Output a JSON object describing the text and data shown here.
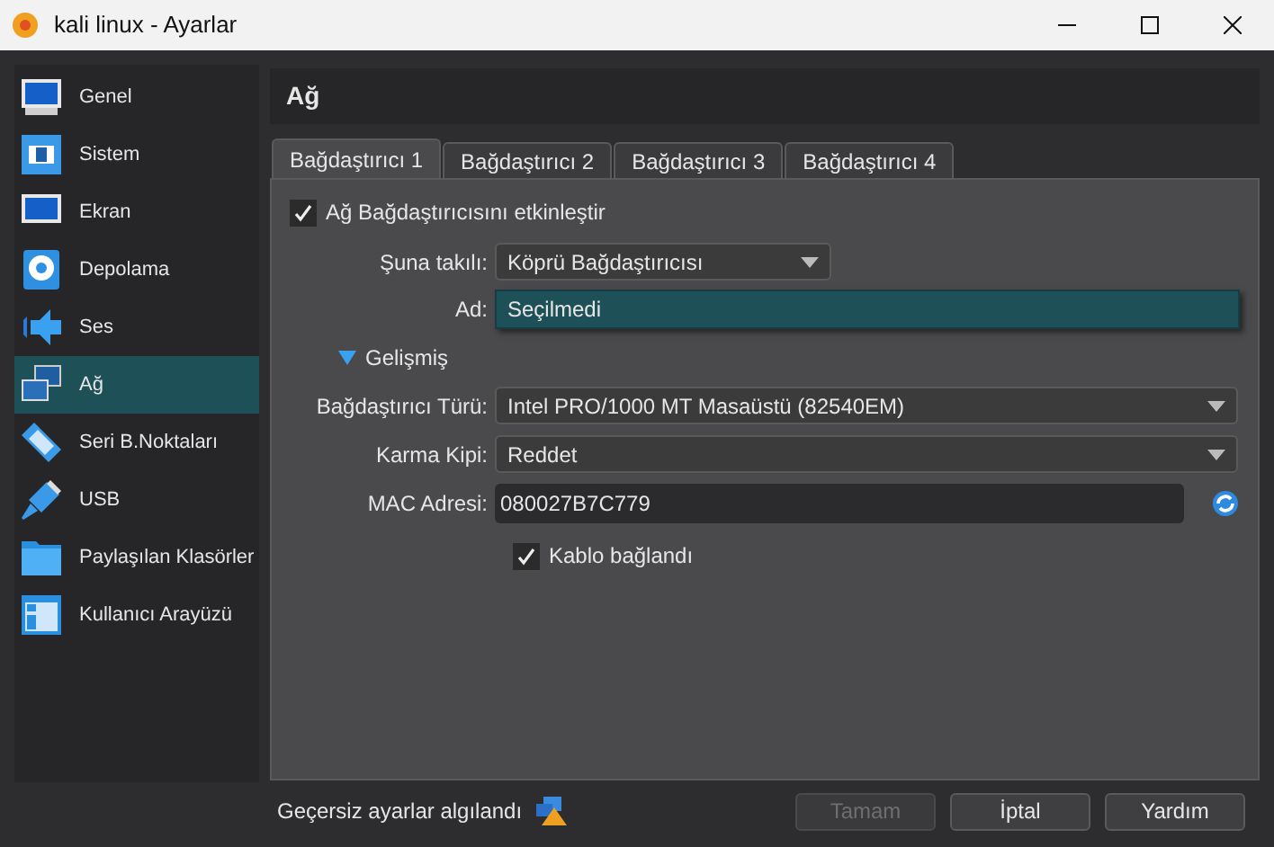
{
  "window": {
    "title": "kali linux - Ayarlar"
  },
  "sidebar": {
    "items": [
      {
        "label": "Genel",
        "selected": false
      },
      {
        "label": "Sistem",
        "selected": false
      },
      {
        "label": "Ekran",
        "selected": false
      },
      {
        "label": "Depolama",
        "selected": false
      },
      {
        "label": "Ses",
        "selected": false
      },
      {
        "label": "Ağ",
        "selected": true
      },
      {
        "label": "Seri B.Noktaları",
        "selected": false
      },
      {
        "label": "USB",
        "selected": false
      },
      {
        "label": "Paylaşılan Klasörler",
        "selected": false
      },
      {
        "label": "Kullanıcı Arayüzü",
        "selected": false
      }
    ]
  },
  "page": {
    "title": "Ağ"
  },
  "tabs": [
    {
      "label": "Bağdaştırıcı 1",
      "selected": true
    },
    {
      "label": "Bağdaştırıcı 2",
      "selected": false
    },
    {
      "label": "Bağdaştırıcı 3",
      "selected": false
    },
    {
      "label": "Bağdaştırıcı 4",
      "selected": false
    }
  ],
  "form": {
    "enable": {
      "label": "Ağ Bağdaştırıcısını etkinleştir",
      "checked": true
    },
    "attached_to": {
      "label": "Şuna takılı:",
      "value": "Köprü Bağdaştırıcısı"
    },
    "name": {
      "label": "Ad:",
      "value": "Seçilmedi"
    },
    "advanced": {
      "label": "Gelişmiş",
      "expanded": true
    },
    "adapter_type": {
      "label": "Bağdaştırıcı Türü:",
      "value": "Intel PRO/1000 MT Masaüstü (82540EM)"
    },
    "promiscuous": {
      "label": "Karma Kipi:",
      "value": "Reddet"
    },
    "mac": {
      "label": "MAC Adresi:",
      "value": "080027B7C779"
    },
    "cable": {
      "label": "Kablo bağlandı",
      "checked": true
    }
  },
  "status": {
    "text": "Geçersiz ayarlar algılandı"
  },
  "buttons": [
    {
      "label": "Tamam",
      "disabled": true
    },
    {
      "label": "İptal",
      "disabled": false
    },
    {
      "label": "Yardım",
      "disabled": false
    }
  ]
}
